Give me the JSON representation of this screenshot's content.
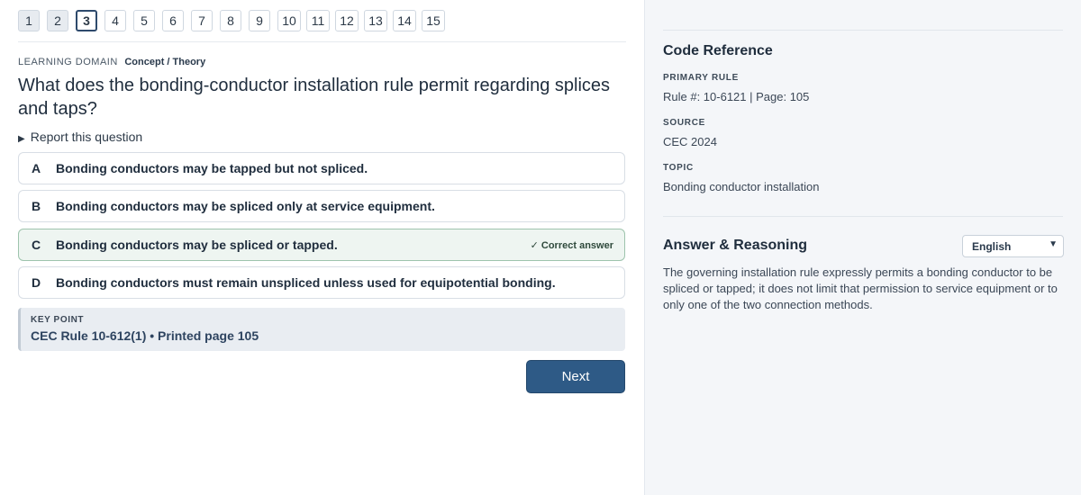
{
  "pagination": {
    "pages": [
      "1",
      "2",
      "3",
      "4",
      "5",
      "6",
      "7",
      "8",
      "9",
      "10",
      "11",
      "12",
      "13",
      "14",
      "15"
    ],
    "current": "3"
  },
  "learning_domain": {
    "label": "LEARNING DOMAIN",
    "value": "Concept / Theory"
  },
  "question": "What does the bonding-conductor installation rule permit regarding splices and taps?",
  "report_link": "Report this question",
  "options": [
    {
      "letter": "A",
      "text": "Bonding conductors may be tapped but not spliced.",
      "correct": false
    },
    {
      "letter": "B",
      "text": "Bonding conductors may be spliced only at service equipment.",
      "correct": false
    },
    {
      "letter": "C",
      "text": "Bonding conductors may be spliced or tapped.",
      "correct": true
    },
    {
      "letter": "D",
      "text": "Bonding conductors must remain unspliced unless used for equipotential bonding.",
      "correct": false
    }
  ],
  "correct_badge": "✓ Correct answer",
  "key_point": {
    "label": "KEY POINT",
    "text": "CEC Rule 10-612(1) • Printed page 105"
  },
  "next_button": "Next",
  "code_reference": {
    "title": "Code Reference",
    "primary_rule_label": "PRIMARY RULE",
    "primary_rule_value": "Rule #: 10-6121 | Page: 105",
    "source_label": "SOURCE",
    "source_value": "CEC 2024",
    "topic_label": "TOPIC",
    "topic_value": "Bonding conductor installation"
  },
  "answer_reasoning": {
    "title": "Answer & Reasoning",
    "language": "English",
    "text": "The governing installation rule expressly permits a bonding conductor to be spliced or tapped; it does not limit that permission to service equipment or to only one of the two connection methods."
  },
  "colors": {
    "accent": "#2e5a86",
    "correct_bg": "#eef5f1",
    "panel_bg": "#f4f6f9"
  },
  "icons": {
    "report": "triangle-right-icon",
    "language": "chevron-down-icon",
    "correct": "check-icon"
  }
}
